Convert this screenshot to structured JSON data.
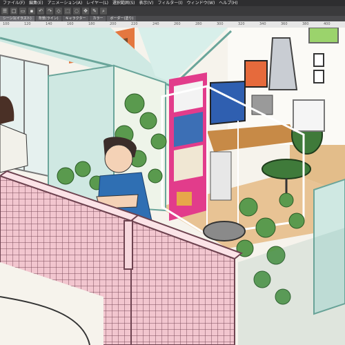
{
  "menubar": {
    "items": [
      "ファイル(F)",
      "編集(E)",
      "アニメーション(A)",
      "レイヤー(L)",
      "選択範囲(S)",
      "表示(V)",
      "フィルター(I)",
      "ウィンドウ(W)",
      "ヘルプ(H)"
    ]
  },
  "toolbar": {
    "icons": [
      "menu-icon",
      "new-file-icon",
      "open-icon",
      "save-icon",
      "undo-icon",
      "redo-icon",
      "eraser-icon",
      "select-icon",
      "lasso-icon",
      "move-icon",
      "brush-icon",
      "zoom-icon"
    ]
  },
  "tabs": [
    {
      "label": "シーン1(イラスト)"
    },
    {
      "label": "背景(ライン)"
    },
    {
      "label": "キャラクター"
    },
    {
      "label": "カラー"
    },
    {
      "label": "ボーダー(塗り)"
    }
  ],
  "ruler": {
    "ticks": [
      "100",
      "120",
      "140",
      "160",
      "180",
      "200",
      "220",
      "240",
      "260",
      "280",
      "300",
      "320",
      "340",
      "360",
      "380",
      "400"
    ]
  },
  "colors": {
    "wall_teal": "#bfe3dc",
    "pink_wall": "#f2c6cf",
    "floor": "#e8c394",
    "shelf_magenta": "#e23c8b",
    "ivy": "#5a9a4e",
    "shirt_blue": "#2f6fb3",
    "chair_green": "#3f7a3a"
  }
}
